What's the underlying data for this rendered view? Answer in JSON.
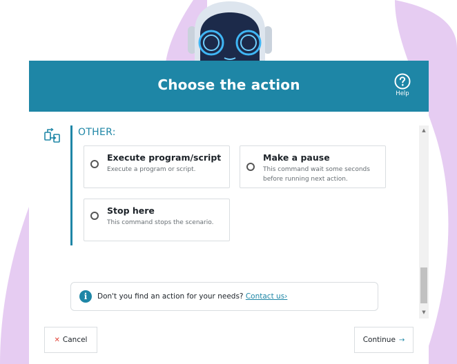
{
  "dialog": {
    "title": "Choose the action",
    "help_label": "Help"
  },
  "category": {
    "title": "OTHER:",
    "options": [
      {
        "title": "Execute program/script",
        "description": "Execute a program or script."
      },
      {
        "title": "Make a pause",
        "description": "This command wait some seconds before running next action."
      },
      {
        "title": "Stop here",
        "description": "This command stops the scenario."
      }
    ]
  },
  "info": {
    "text": "Don't you find an action for your needs?",
    "link": "Contact us›"
  },
  "footer": {
    "cancel_label": "Cancel",
    "continue_label": "Continue"
  },
  "colors": {
    "accent": "#1e86a6",
    "cancel_icon": "#e2463a",
    "background_blob": "#e6ccf2"
  },
  "icons": [
    "robot-mascot",
    "help-circle-icon",
    "swap-boxes-icon",
    "info-icon",
    "close-icon",
    "arrow-right-icon"
  ]
}
